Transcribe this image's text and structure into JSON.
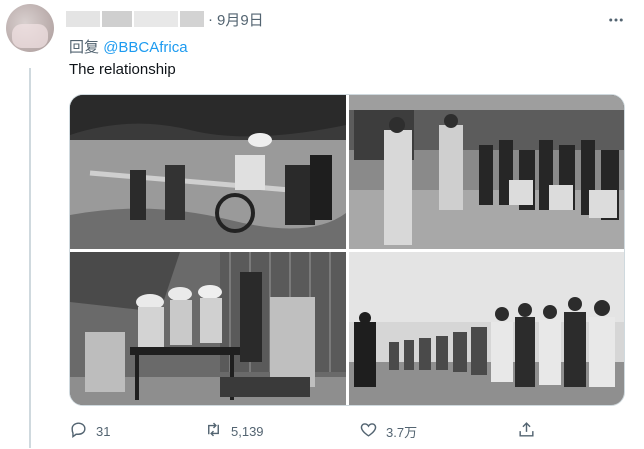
{
  "tweet": {
    "separator": "·",
    "date": "9月9日",
    "reply_prefix": "回复",
    "reply_handle": "@BBCAfrica",
    "text": "The relationship",
    "more_icon": "more-icon"
  },
  "media": {
    "photos": [
      {
        "id": "photo-1",
        "subject": "Man seated in a carried chair"
      },
      {
        "id": "photo-2",
        "subject": "Officers with men raising hands"
      },
      {
        "id": "photo-3",
        "subject": "Men at a table with instruments"
      },
      {
        "id": "photo-4",
        "subject": "Line of men with hands on heads"
      }
    ]
  },
  "actions": {
    "replies": "31",
    "retweets": "5,139",
    "likes": "3.7万"
  },
  "colors": {
    "link": "#1d9bf0",
    "muted": "#536471",
    "text": "#0f1419",
    "border": "#cfd9de"
  }
}
